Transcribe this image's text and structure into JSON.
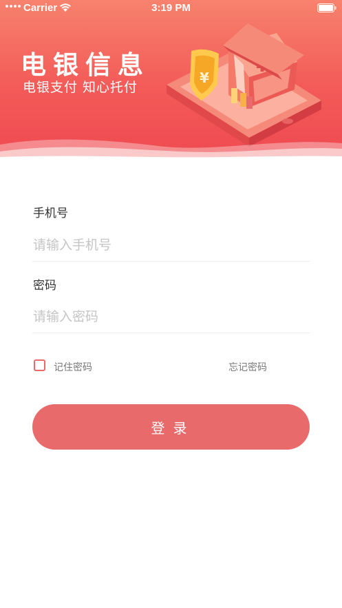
{
  "status_bar": {
    "carrier": "Carrier",
    "time": "3:19 PM"
  },
  "header": {
    "title": "电银信息",
    "slogan": "电银支付 知心托付"
  },
  "form": {
    "phone_label": "手机号",
    "phone_placeholder": "请输入手机号",
    "password_label": "密码",
    "password_placeholder": "请输入密码",
    "remember_label": "记住密码",
    "remember_checked": false,
    "forgot_label": "忘记密码",
    "login_label": "登录"
  },
  "colors": {
    "banner_top": "#f7826d",
    "banner_bottom": "#ef4a50",
    "accent": "#e86a6a",
    "placeholder": "#c5c5c5"
  }
}
